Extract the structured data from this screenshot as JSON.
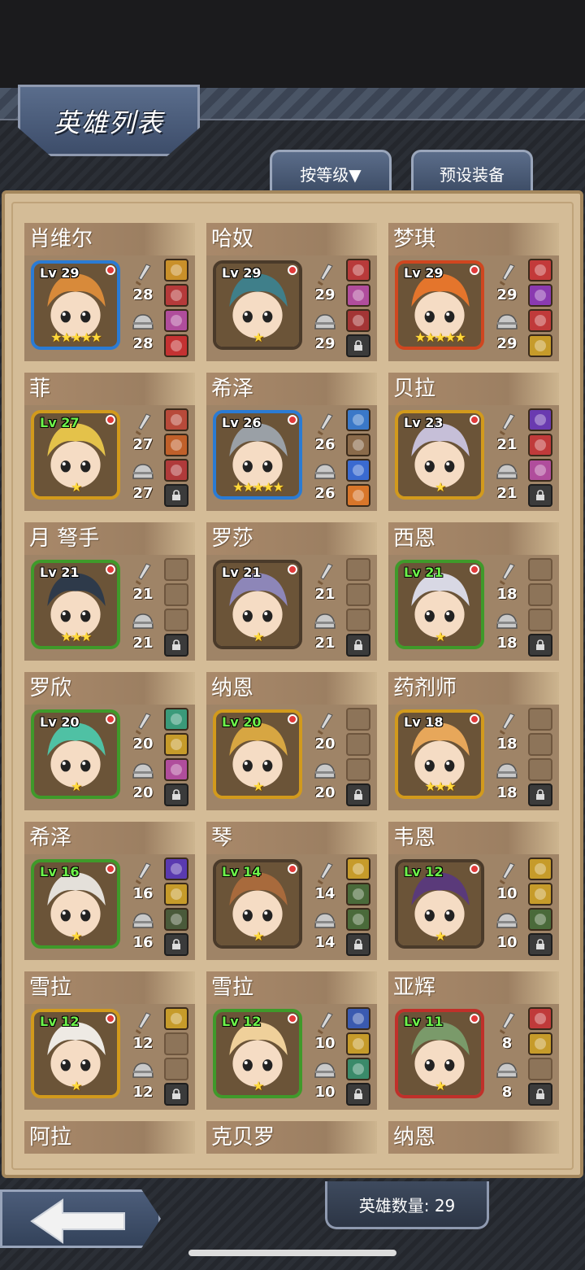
{
  "screen": {
    "title": "英雄列表",
    "sort_button": "按等级▼",
    "preset_button": "预设装备",
    "hero_count_label": "英雄数量: 29",
    "back_icon": "arrow-left-icon"
  },
  "heroes": [
    {
      "name": "肖维尔",
      "level": "Lv 29",
      "level_color": "white",
      "frame": "#2a7bd4",
      "stars": "★★★★★",
      "atk": "28",
      "def": "28",
      "slots": [
        "item:#c9902a",
        "item:#b53a3a",
        "item:#b04d9c",
        "item:#c43232"
      ],
      "art": "#d88a3a"
    },
    {
      "name": "哈奴",
      "level": "Lv 29",
      "level_color": "white",
      "frame": "#4a3a2a",
      "stars": "★",
      "atk": "29",
      "def": "29",
      "slots": [
        "item:#b83a3a",
        "item:#b04d9c",
        "item:#a33535",
        "lock"
      ],
      "art": "#3f7f8a"
    },
    {
      "name": "梦琪",
      "level": "Lv 29",
      "level_color": "white",
      "frame": "#d0461f",
      "stars": "★★★★★",
      "atk": "29",
      "def": "29",
      "slots": [
        "item:#c33a3a",
        "item:#8a3ab0",
        "item:#c03a3a",
        "item:#c69b2a"
      ],
      "art": "#e4752c"
    },
    {
      "name": "菲",
      "level": "Lv 27",
      "level_color": "green",
      "frame": "#d29a1c",
      "stars": "★",
      "atk": "27",
      "def": "27",
      "slots": [
        "item:#b84a3a",
        "item:#c0602a",
        "item:#b03a3a",
        "lock"
      ],
      "art": "#e4c24a"
    },
    {
      "name": "希泽",
      "level": "Lv 26",
      "level_color": "white",
      "frame": "#2a7bd4",
      "stars": "★★★★★",
      "atk": "26",
      "def": "26",
      "slots": [
        "item:#3a78c8",
        "item:#8a6a4a",
        "item:#3a6ad0",
        "item:#d8762a"
      ],
      "art": "#9aa0a6"
    },
    {
      "name": "贝拉",
      "level": "Lv 23",
      "level_color": "white",
      "frame": "#d29a1c",
      "stars": "★",
      "atk": "21",
      "def": "21",
      "slots": [
        "item:#6a3ab0",
        "item:#c03a3a",
        "item:#b04d9c",
        "lock"
      ],
      "art": "#c6bfd8"
    },
    {
      "name": "月 弩手",
      "level": "Lv 21",
      "level_color": "white",
      "frame": "#3f9a2a",
      "stars": "★★★",
      "atk": "21",
      "def": "21",
      "slots": [
        "empty",
        "empty",
        "empty",
        "lock"
      ],
      "art": "#2e3a4a"
    },
    {
      "name": "罗莎",
      "level": "Lv 21",
      "level_color": "white",
      "frame": "#4a3a2a",
      "stars": "★",
      "atk": "21",
      "def": "21",
      "slots": [
        "empty",
        "empty",
        "empty",
        "lock"
      ],
      "art": "#8d86b8"
    },
    {
      "name": "西恩",
      "level": "Lv 21",
      "level_color": "green",
      "frame": "#3f9a2a",
      "stars": "★",
      "atk": "18",
      "def": "18",
      "slots": [
        "empty",
        "empty",
        "empty",
        "lock"
      ],
      "art": "#d8d8e4"
    },
    {
      "name": "罗欣",
      "level": "Lv 20",
      "level_color": "white",
      "frame": "#3f9a2a",
      "stars": "★",
      "atk": "20",
      "def": "20",
      "slots": [
        "item:#3a9a7a",
        "item:#c69b2a",
        "item:#b04d9c",
        "lock"
      ],
      "art": "#4fc1a4"
    },
    {
      "name": "纳恩",
      "level": "Lv 20",
      "level_color": "green",
      "frame": "#d29a1c",
      "stars": "★",
      "atk": "20",
      "def": "20",
      "slots": [
        "empty",
        "empty",
        "empty",
        "lock"
      ],
      "art": "#d7a642"
    },
    {
      "name": "药剂师",
      "level": "Lv 18",
      "level_color": "white",
      "frame": "#d29a1c",
      "stars": "★★★",
      "atk": "18",
      "def": "18",
      "slots": [
        "empty",
        "empty",
        "empty",
        "lock"
      ],
      "art": "#e7a75a"
    },
    {
      "name": "希泽",
      "level": "Lv 16",
      "level_color": "green",
      "frame": "#3f9a2a",
      "stars": "★",
      "atk": "16",
      "def": "16",
      "slots": [
        "item:#5a3ab0",
        "item:#c69b2a",
        "item:#4a5a3a",
        "lock"
      ],
      "art": "#e4e0da"
    },
    {
      "name": "琴",
      "level": "Lv 14",
      "level_color": "green",
      "frame": "#4a3a2a",
      "stars": "★",
      "atk": "14",
      "def": "14",
      "slots": [
        "item:#c69b2a",
        "item:#4a6a3a",
        "item:#4a6a3a",
        "lock"
      ],
      "art": "#a86a3c"
    },
    {
      "name": "韦恩",
      "level": "Lv 12",
      "level_color": "green",
      "frame": "#4a3a2a",
      "stars": "★",
      "atk": "10",
      "def": "10",
      "slots": [
        "item:#c69b2a",
        "item:#c69b2a",
        "item:#4a6a3a",
        "lock"
      ],
      "art": "#5a3a7a"
    },
    {
      "name": "雪拉",
      "level": "Lv 12",
      "level_color": "green",
      "frame": "#d29a1c",
      "stars": "★",
      "atk": "12",
      "def": "12",
      "slots": [
        "item:#c69b2a",
        "empty",
        "empty",
        "lock"
      ],
      "art": "#eeeae4"
    },
    {
      "name": "雪拉",
      "level": "Lv 12",
      "level_color": "green",
      "frame": "#3f9a2a",
      "stars": "★",
      "atk": "10",
      "def": "10",
      "slots": [
        "item:#3a5ab0",
        "item:#c69b2a",
        "item:#3a8a6a",
        "lock"
      ],
      "art": "#efd09a"
    },
    {
      "name": "亚辉",
      "level": "Lv 11",
      "level_color": "green",
      "frame": "#c0302a",
      "stars": "★",
      "atk": "8",
      "def": "8",
      "slots": [
        "item:#c03a3a",
        "item:#c69b2a",
        "empty",
        "lock"
      ],
      "art": "#7a9a6a"
    },
    {
      "name": "阿拉"
    },
    {
      "name": "克贝罗"
    },
    {
      "name": "纳恩"
    }
  ]
}
